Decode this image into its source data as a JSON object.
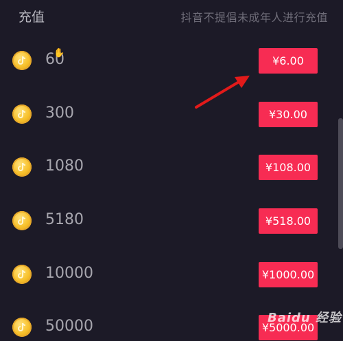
{
  "header": {
    "title": "充值",
    "notice": "抖音不提倡未成年人进行充值"
  },
  "recharge_options": [
    {
      "coins": "60",
      "price": "¥6.00"
    },
    {
      "coins": "300",
      "price": "¥30.00"
    },
    {
      "coins": "1080",
      "price": "¥108.00"
    },
    {
      "coins": "5180",
      "price": "¥518.00"
    },
    {
      "coins": "10000",
      "price": "¥1000.00"
    },
    {
      "coins": "50000",
      "price": "¥5000.00"
    }
  ],
  "watermark": {
    "text": "Baidu 经验"
  },
  "colors": {
    "background": "#1c1a27",
    "button": "#f72c53",
    "annotation_arrow": "#e21a1a",
    "coin": "#f7c02a"
  },
  "icons": {
    "coin": "coin-icon",
    "arrow": "red-arrow-annotation",
    "cursor": "hand-cursor-icon"
  }
}
